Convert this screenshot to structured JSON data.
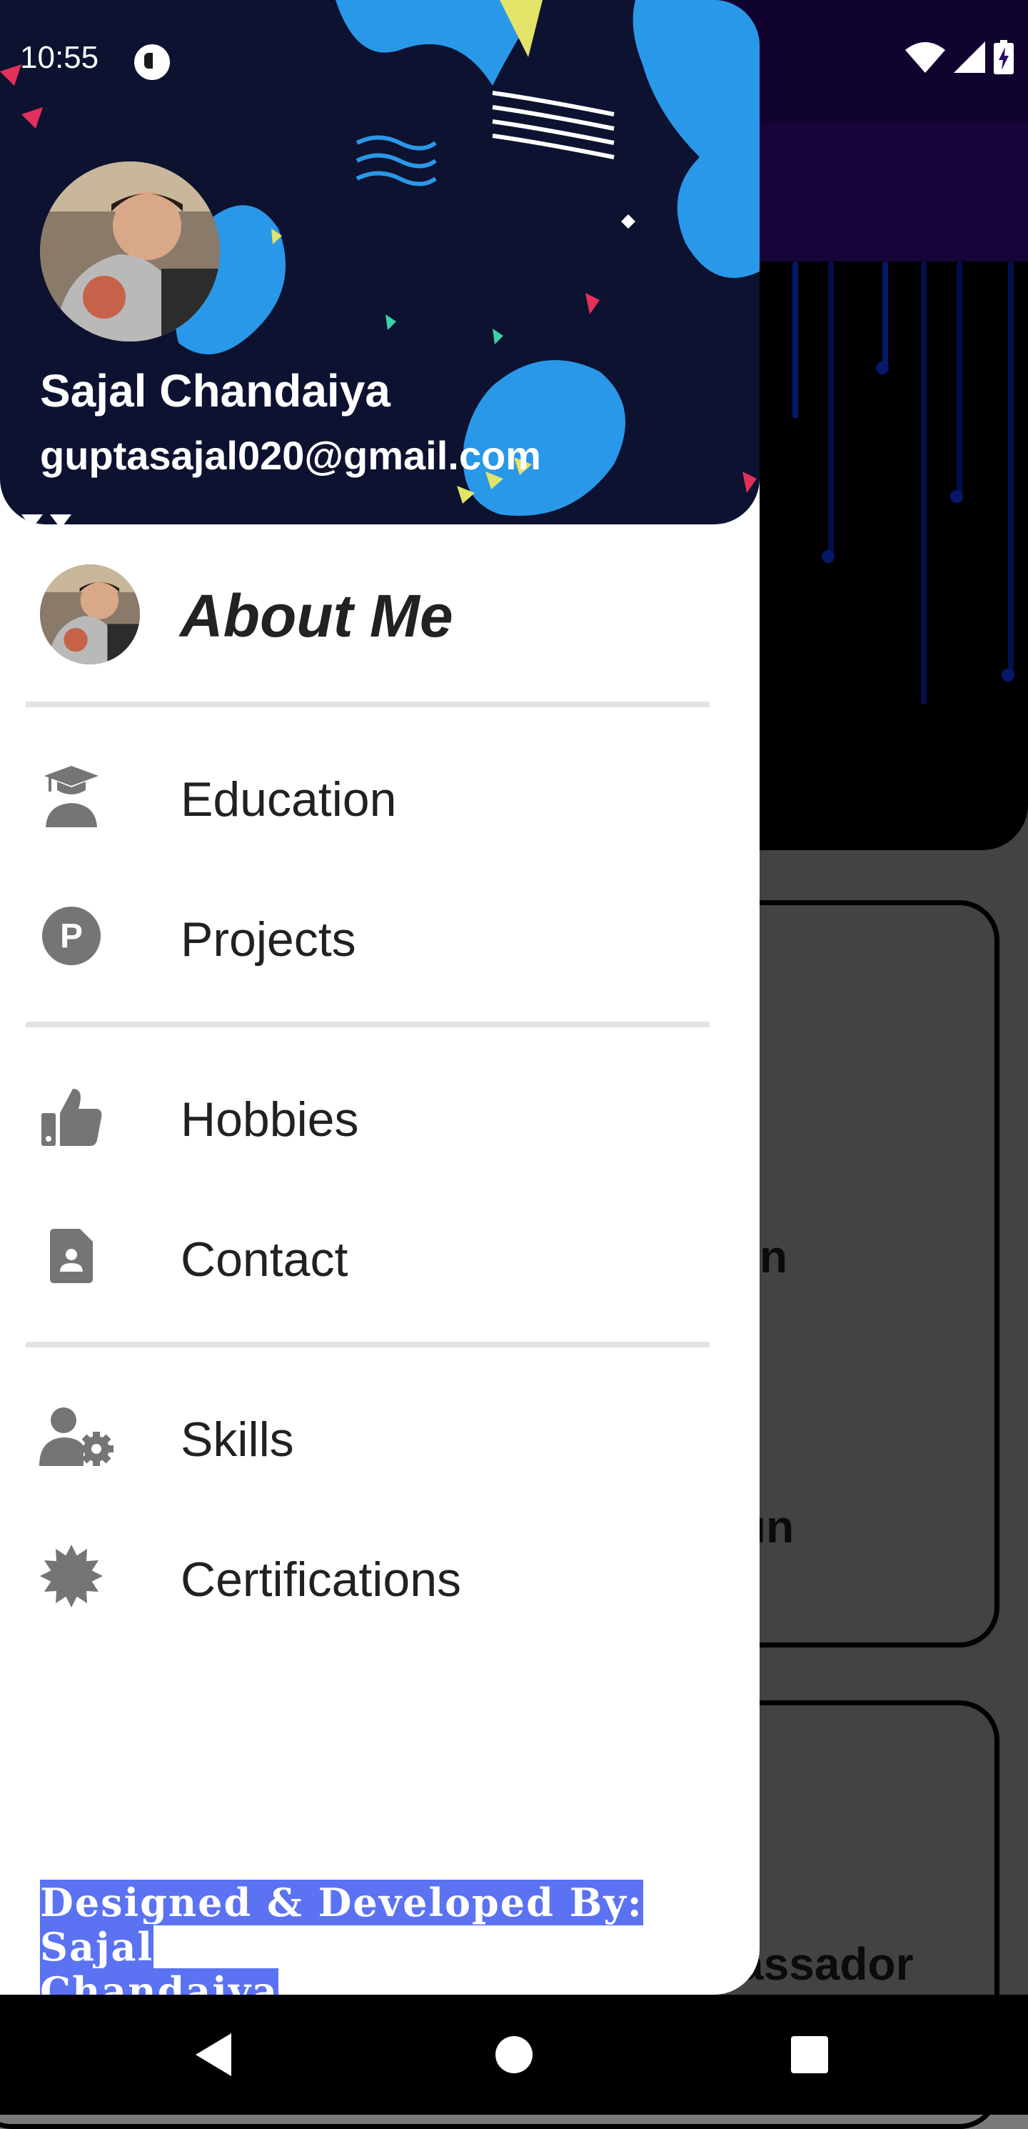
{
  "status_bar": {
    "time": "10:55",
    "icons": [
      "notification-icon",
      "wifi-icon",
      "signal-icon",
      "battery-icon"
    ]
  },
  "background_app": {
    "visible_fragments": [
      "n",
      "un",
      "assador"
    ]
  },
  "drawer": {
    "header": {
      "name": "Sajal Chandaiya",
      "email": "guptasajal020@gmail.com"
    },
    "about": {
      "label": "About Me"
    },
    "groups": [
      [
        {
          "label": "Education",
          "icon": "graduate-icon"
        },
        {
          "label": "Projects",
          "icon": "p-circle-icon"
        }
      ],
      [
        {
          "label": "Hobbies",
          "icon": "thumbs-up-icon"
        },
        {
          "label": "Contact",
          "icon": "contact-card-icon"
        }
      ],
      [
        {
          "label": "Skills",
          "icon": "user-gear-icon"
        },
        {
          "label": "Certifications",
          "icon": "certificate-badge-icon"
        }
      ]
    ],
    "footer": {
      "line1": "Designed & Developed By: Sajal ",
      "line2": "Chandaiya"
    }
  },
  "nav_bar": {
    "buttons": [
      "back-icon",
      "home-icon",
      "recents-icon"
    ]
  },
  "colors": {
    "app_bar": "#2b0a6b",
    "drawer_bg": "#ffffff",
    "icon_gray": "#757575",
    "credit_highlight": "#5b72f2"
  }
}
